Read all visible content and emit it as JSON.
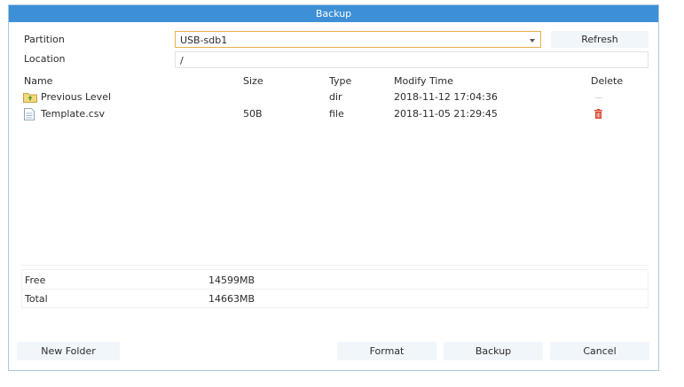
{
  "window": {
    "title": "Backup"
  },
  "form": {
    "partition_label": "Partition",
    "partition_value": "USB-sdb1",
    "refresh_label": "Refresh",
    "location_label": "Location",
    "location_value": "/"
  },
  "table": {
    "headers": {
      "name": "Name",
      "size": "Size",
      "type": "Type",
      "modify_time": "Modify Time",
      "delete": "Delete"
    },
    "rows": [
      {
        "icon": "folder-up-icon",
        "name": "Previous Level",
        "size": "",
        "type": "dir",
        "modify_time": "2018-11-12 17:04:36"
      },
      {
        "icon": "file-icon",
        "name": "Template.csv",
        "size": "50B",
        "type": "file",
        "modify_time": "2018-11-05 21:29:45",
        "delete_icon": "trash-icon"
      }
    ]
  },
  "storage": {
    "free_label": "Free",
    "free_value": "14599MB",
    "total_label": "Total",
    "total_value": "14663MB"
  },
  "buttons": {
    "new_folder": "New Folder",
    "format": "Format",
    "backup": "Backup",
    "cancel": "Cancel"
  },
  "colors": {
    "title_bar": "#3d8fd6",
    "select_border": "#e8b04a",
    "delete_icon": "#d9452b"
  }
}
